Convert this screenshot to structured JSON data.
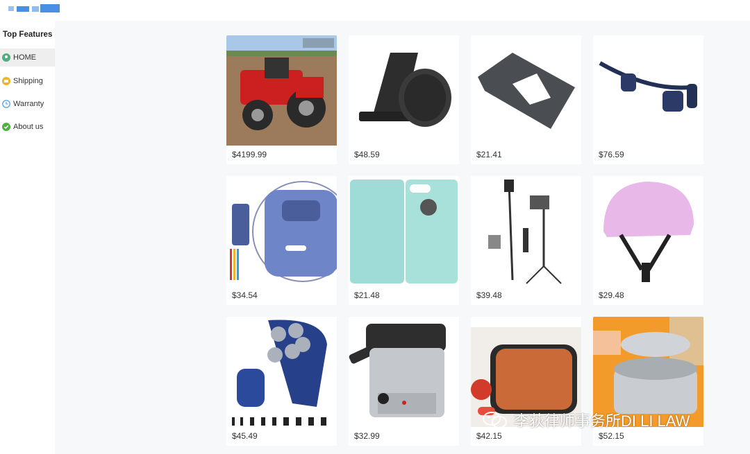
{
  "sidebar": {
    "title": "Top Features",
    "items": [
      {
        "label": "HOME",
        "icon": "map-pin-icon",
        "color": "#4caf7d",
        "active": true
      },
      {
        "label": "Shipping",
        "icon": "shipping-icon",
        "color": "#f0b429"
      },
      {
        "label": "Warranty",
        "icon": "clock-icon",
        "color": "#5aa9e6"
      },
      {
        "label": "About us",
        "icon": "check-shield-icon",
        "color": "#52b043"
      }
    ]
  },
  "products": [
    {
      "name": "red-tractor",
      "price": "$4199.99"
    },
    {
      "name": "wireless-charger-stand",
      "price": "$48.59"
    },
    {
      "name": "tablet-stand",
      "price": "$21.41"
    },
    {
      "name": "bone-conduction-headphones",
      "price": "$76.59"
    },
    {
      "name": "electric-pencil-sharpener",
      "price": "$34.54"
    },
    {
      "name": "phone-wallet-case",
      "price": "$21.48"
    },
    {
      "name": "selfie-stick-tripod",
      "price": "$39.48"
    },
    {
      "name": "pink-helmet",
      "price": "$29.48"
    },
    {
      "name": "rotary-shaver",
      "price": "$45.49"
    },
    {
      "name": "deep-fryer",
      "price": "$32.99"
    },
    {
      "name": "copper-grill-pan",
      "price": "$42.15"
    },
    {
      "name": "tempura-fryer-pot",
      "price": "$52.15"
    }
  ],
  "watermark": {
    "text": "李荻律师事务所DI LI LAW",
    "icon": "wechat-icon"
  }
}
